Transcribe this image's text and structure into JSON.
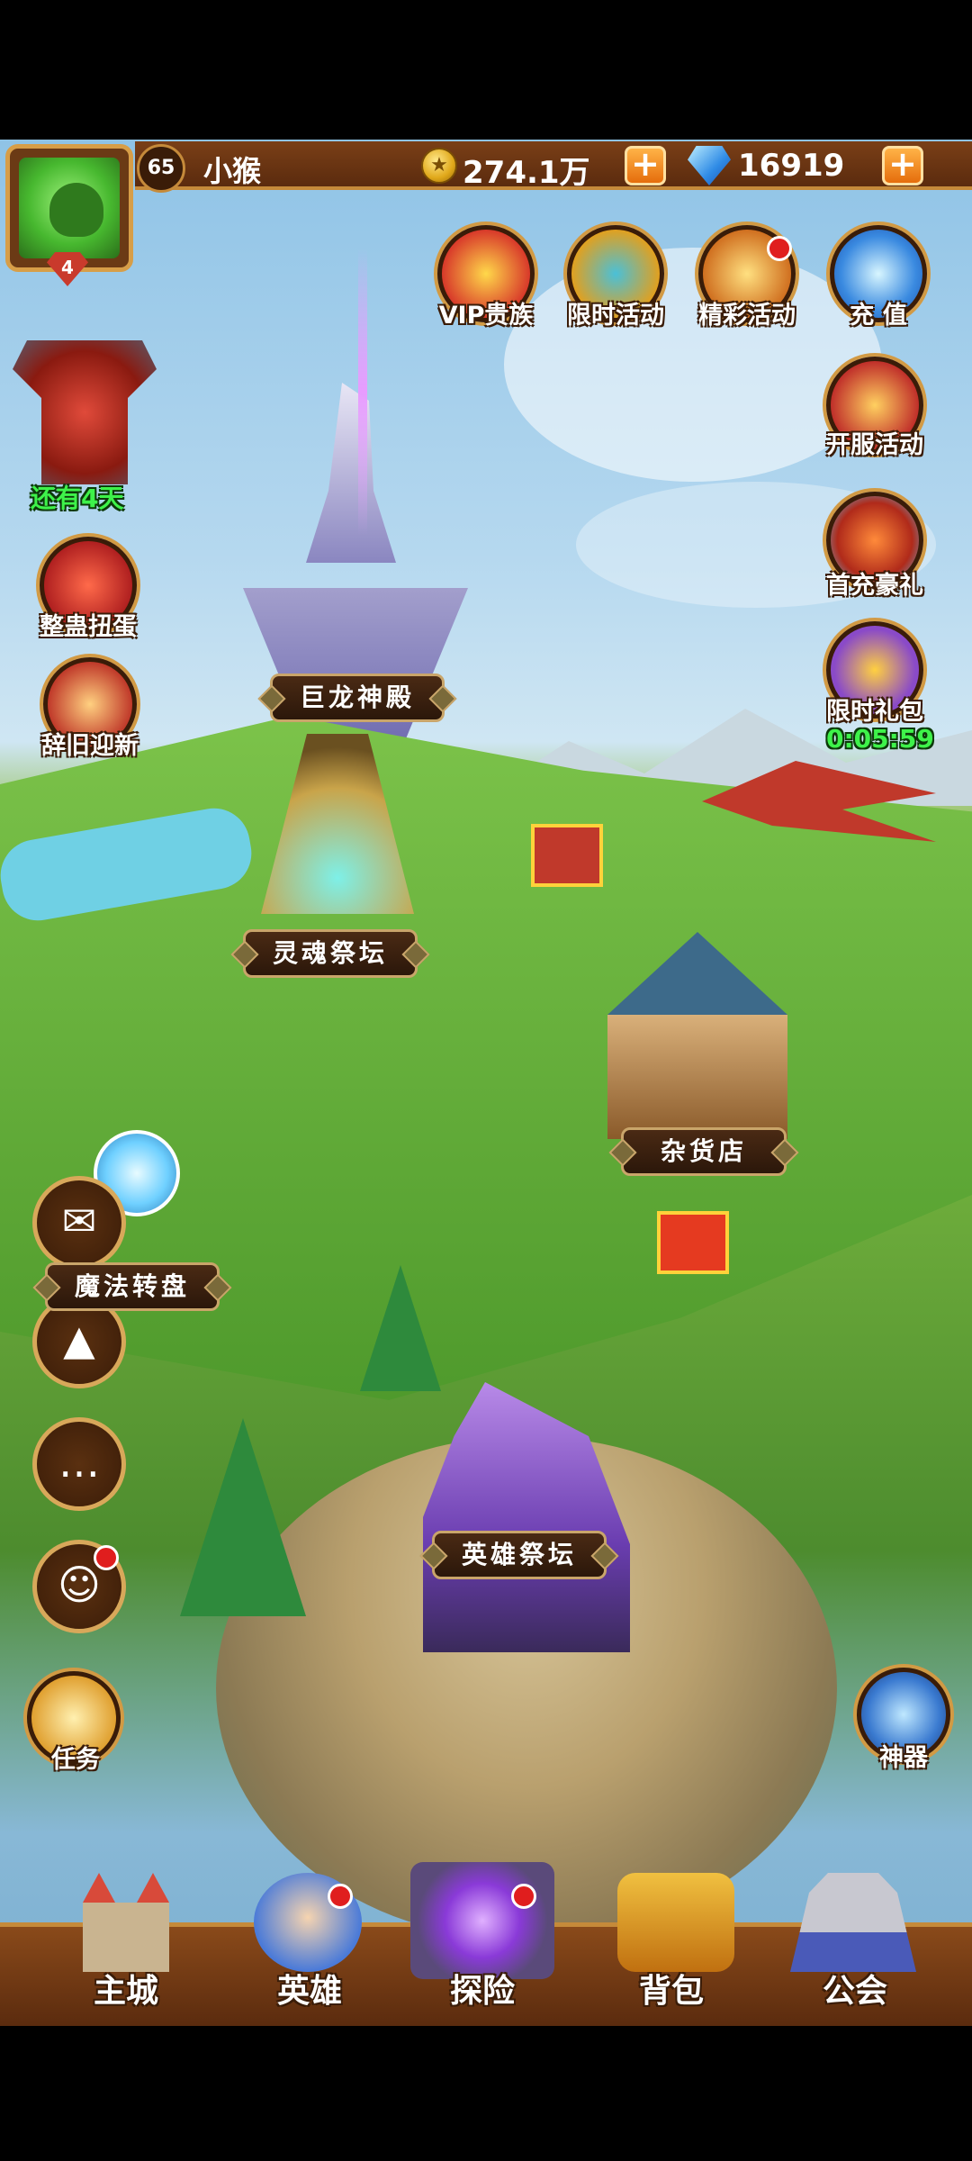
{
  "player": {
    "level": "65",
    "avatar_badge": "4",
    "name": "小猴"
  },
  "resources": {
    "gold": "274.1万",
    "diamonds": "16919"
  },
  "top_icons": [
    {
      "label": "VIP贵族",
      "icon": "crown-icon",
      "dot": false
    },
    {
      "label": "限时活动",
      "icon": "compass-icon",
      "dot": false
    },
    {
      "label": "精彩活动",
      "icon": "scroll-icon",
      "dot": true
    },
    {
      "label": "充 值",
      "icon": "diamond-icon",
      "dot": false
    }
  ],
  "right_icons": {
    "opening": "开服活动",
    "first_recharge": "首充豪礼",
    "limited_gift": "限时礼包",
    "gift_timer": "0:05:59",
    "artifact": "神器"
  },
  "left_icons": {
    "event_timer": "还有4天",
    "gacha": "整蛊扭蛋",
    "new_year": "辞旧迎新",
    "quest": "任务"
  },
  "buildings": {
    "dragon_temple": "巨龙神殿",
    "soul_altar": "灵魂祭坛",
    "shop": "杂货店",
    "magic_wheel": "魔法转盘",
    "hero_altar": "英雄祭坛"
  },
  "side_buttons": [
    "mail-icon",
    "ranking-icon",
    "chat-icon",
    "friends-icon"
  ],
  "nav": [
    {
      "label": "主城",
      "dot": false
    },
    {
      "label": "英雄",
      "dot": true
    },
    {
      "label": "探险",
      "dot": true
    },
    {
      "label": "背包",
      "dot": false
    },
    {
      "label": "公会",
      "dot": false
    }
  ],
  "colors": {
    "frame": "#5b2b0e",
    "accent": "#d29a44",
    "timer_green": "#3ef24a",
    "alert_red": "#e01e1e"
  }
}
